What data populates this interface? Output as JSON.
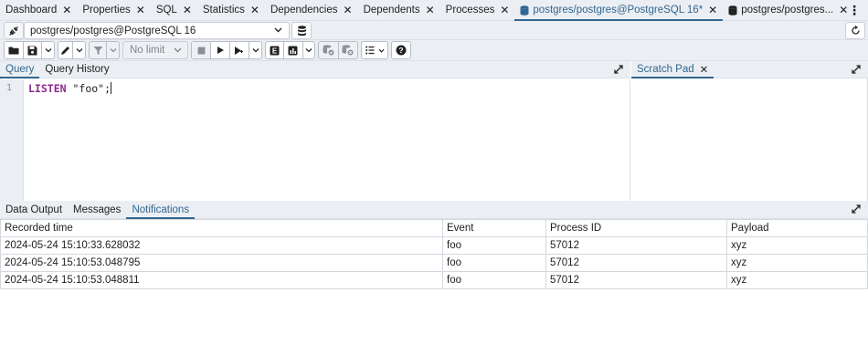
{
  "tabs": [
    {
      "label": "Dashboard",
      "active": false
    },
    {
      "label": "Properties",
      "active": false
    },
    {
      "label": "SQL",
      "active": false
    },
    {
      "label": "Statistics",
      "active": false
    },
    {
      "label": "Dependencies",
      "active": false
    },
    {
      "label": "Dependents",
      "active": false
    },
    {
      "label": "Processes",
      "active": false
    },
    {
      "label": "postgres/postgres@PostgreSQL 16*",
      "active": true
    },
    {
      "label": "postgres/postgres...",
      "active": false
    }
  ],
  "connection": {
    "value": "postgres/postgres@PostgreSQL 16"
  },
  "toolbar": {
    "limit_label": "No limit"
  },
  "editor_tabs": {
    "query": "Query",
    "history": "Query History",
    "scratch": "Scratch Pad"
  },
  "editor": {
    "line_number": "1",
    "keyword": "LISTEN",
    "string": "\"foo\"",
    "terminator": ";"
  },
  "output_tabs": {
    "data_output": "Data Output",
    "messages": "Messages",
    "notifications": "Notifications"
  },
  "notifications": {
    "columns": [
      "Recorded time",
      "Event",
      "Process ID",
      "Payload"
    ],
    "rows": [
      [
        "2024-05-24 15:10:33.628032",
        "foo",
        "57012",
        "xyz"
      ],
      [
        "2024-05-24 15:10:53.048795",
        "foo",
        "57012",
        "xyz"
      ],
      [
        "2024-05-24 15:10:53.048811",
        "foo",
        "57012",
        "xyz"
      ]
    ]
  },
  "colors": {
    "accent": "#326690",
    "toolbar_bg": "#ebeef3",
    "keyword": "#8b2a8b"
  }
}
